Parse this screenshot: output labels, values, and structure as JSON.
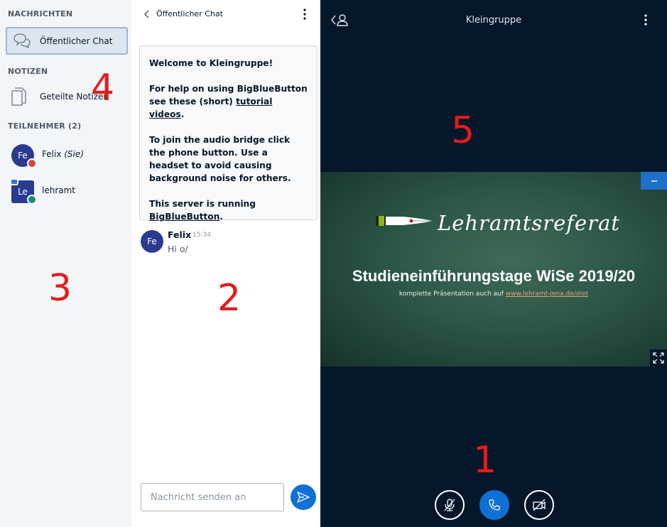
{
  "sidebar": {
    "messages_title": "NACHRICHTEN",
    "public_chat_label": "Öffentlicher Chat",
    "notes_title": "NOTIZEN",
    "shared_notes_label": "Geteilte Notizen",
    "participants_title": "TEILNEHMER (2)",
    "users": [
      {
        "initials": "Fe",
        "name": "Felix",
        "suffix": "(Sie)",
        "avatar_color": "#2a3a8f",
        "badge_color": "#d64a3a"
      },
      {
        "initials": "Le",
        "name": "lehramt",
        "suffix": "",
        "avatar_color": "#2a3a8f",
        "badge_color": "#1a8a78"
      }
    ]
  },
  "chat": {
    "title": "Öffentlicher Chat",
    "welcome": {
      "line1_pre": "Welcome to ",
      "line1_bold": "Kleingruppe",
      "line1_post": "!",
      "line2_pre": "For help on using BigBlueButton see these (short) ",
      "line2_link": "tutorial videos",
      "line2_post": ".",
      "line3": "To join the audio bridge click the phone button. Use a headset to avoid causing background noise for others.",
      "line4_pre": "This server is running ",
      "line4_link": "BigBlueButton",
      "line4_post": "."
    },
    "messages": [
      {
        "initials": "Fe",
        "sender": "Felix",
        "time": "15:34",
        "text": "Hi o/"
      }
    ],
    "input_placeholder": "Nachricht senden an"
  },
  "main": {
    "title": "Kleingruppe",
    "slide": {
      "script_title": "Lehramtsreferat",
      "headline": "Studieneinführungstage WiSe 2019/20",
      "sub_pre": "komplette Präsentation auch auf ",
      "sub_link": "www.lehramt-jena.de/stet"
    }
  },
  "annotations": [
    "1",
    "2",
    "3",
    "4",
    "5"
  ],
  "colors": {
    "accent": "#0f70d7",
    "background_dark": "#06172a",
    "sidebar_bg": "#f3f6f9",
    "annotation": "#e51c1c"
  },
  "icons": [
    "chat-bubbles-icon",
    "notes-icon",
    "back-chevron-icon",
    "more-options-icon",
    "send-icon",
    "user-list-icon",
    "minimize-icon",
    "fullscreen-icon",
    "mute-microphone-icon",
    "phone-icon",
    "video-off-icon"
  ]
}
